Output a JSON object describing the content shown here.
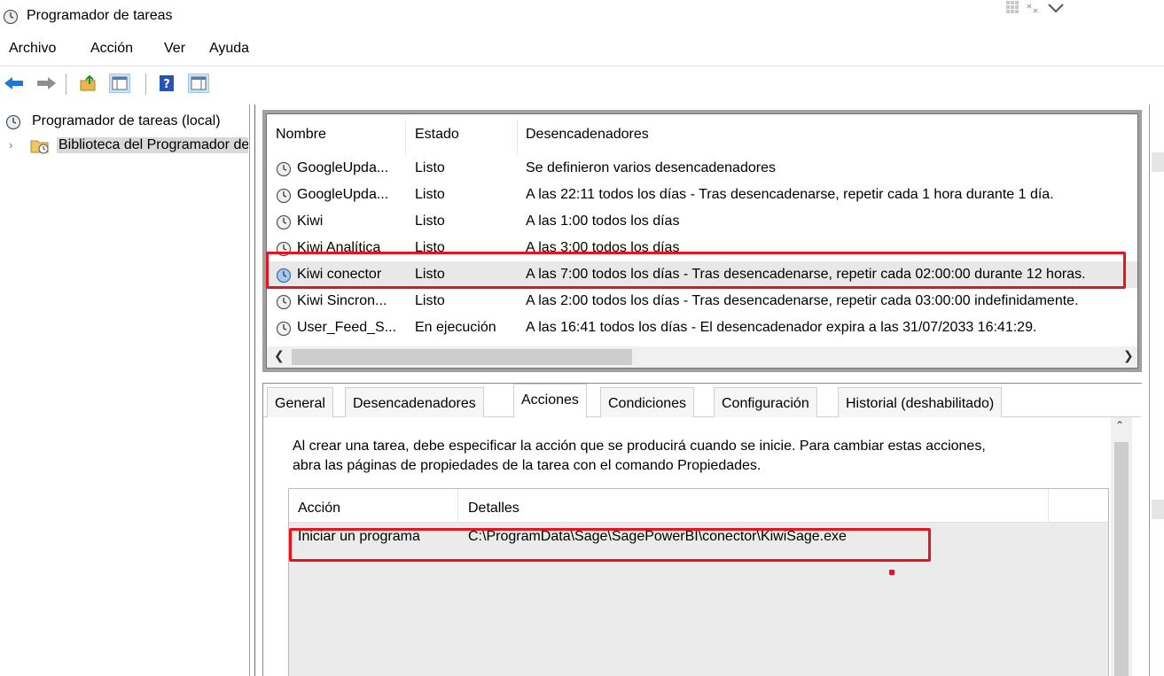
{
  "window": {
    "title": "Programador de tareas"
  },
  "menu": [
    "Archivo",
    "Acción",
    "Ver",
    "Ayuda"
  ],
  "toolbar": {
    "buttons": [
      "back-icon",
      "forward-icon",
      "up-folder-icon",
      "show-hide-tree-icon",
      "help-icon",
      "show-hide-action-pane-icon"
    ]
  },
  "tree": {
    "items": [
      {
        "label": "Programador de tareas (local)",
        "icon": "clock-icon"
      },
      {
        "label": "Biblioteca del Programador de tareas",
        "icon": "folder-clock-icon",
        "selected": true
      }
    ]
  },
  "task_list": {
    "columns": [
      "Nombre",
      "Estado",
      "Desencadenadores"
    ],
    "rows": [
      {
        "name": "GoogleUpda...",
        "status": "Listo",
        "trigger": "Se definieron varios desencadenadores"
      },
      {
        "name": "GoogleUpda...",
        "status": "Listo",
        "trigger": "A las 22:11 todos los días - Tras desencadenarse, repetir cada 1 hora durante 1 día."
      },
      {
        "name": "Kiwi",
        "status": "Listo",
        "trigger": "A las 1:00 todos los días"
      },
      {
        "name": "Kiwi Analítica",
        "status": "Listo",
        "trigger": "A las 3:00 todos los días"
      },
      {
        "name": "Kiwi conector",
        "status": "Listo",
        "trigger": "A las 7:00 todos los días - Tras desencadenarse, repetir cada 02:00:00 durante 12 horas.",
        "selected": true,
        "highlighted": true
      },
      {
        "name": "Kiwi Sincron...",
        "status": "Listo",
        "trigger": "A las 2:00 todos los días - Tras desencadenarse, repetir cada 03:00:00 indefinidamente."
      },
      {
        "name": "User_Feed_S...",
        "status": "En ejecución",
        "trigger": "A las 16:41 todos los días - El desencadenador expira a las 31/07/2033 16:41:29."
      }
    ]
  },
  "details": {
    "tabs": [
      "General",
      "Desencadenadores",
      "Acciones",
      "Condiciones",
      "Configuración",
      "Historial (deshabilitado)"
    ],
    "active_tab": "Acciones",
    "description_line1": "Al crear una tarea, debe especificar la acción que se producirá cuando se inicie. Para cambiar estas acciones,",
    "description_line2": "abra las páginas de propiedades de la tarea con el comando Propiedades.",
    "actions_columns": [
      "Acción",
      "Detalles"
    ],
    "actions_rows": [
      {
        "action": "Iniciar un programa",
        "details": "C:\\ProgramData\\Sage\\SagePowerBI\\conector\\KiwiSage.exe",
        "highlighted": true
      }
    ]
  },
  "colors": {
    "highlight": "#e8141b",
    "selection": "#e8e8e8",
    "tab_active": "#ffffff"
  }
}
